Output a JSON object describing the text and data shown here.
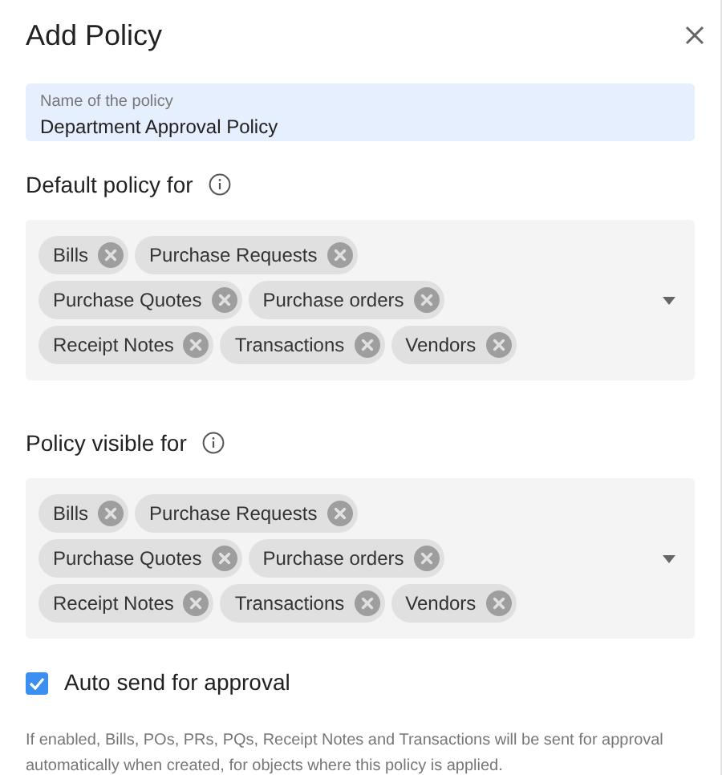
{
  "title": "Add Policy",
  "name_field": {
    "label": "Name of the policy",
    "value": "Department Approval Policy"
  },
  "sections": [
    {
      "label": "Default policy for",
      "chips": [
        "Bills",
        "Purchase Requests",
        "Purchase Quotes",
        "Purchase orders",
        "Receipt Notes",
        "Transactions",
        "Vendors"
      ]
    },
    {
      "label": "Policy visible for",
      "chips": [
        "Bills",
        "Purchase Requests",
        "Purchase Quotes",
        "Purchase orders",
        "Receipt Notes",
        "Transactions",
        "Vendors"
      ]
    }
  ],
  "auto_send": {
    "label": "Auto send for approval",
    "checked": true
  },
  "help_text": "If enabled, Bills, POs, PRs, PQs, Receipt Notes and Transactions will be sent for approval automatically when created, for objects where this policy is applied."
}
